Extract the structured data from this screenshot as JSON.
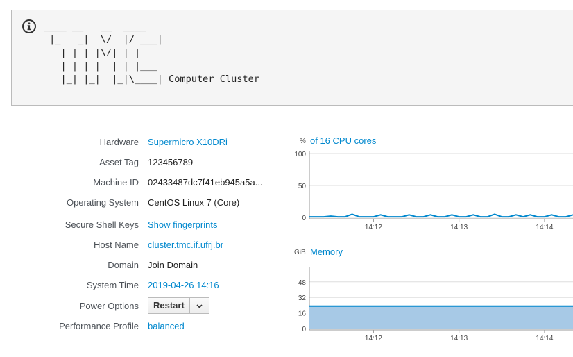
{
  "banner": {
    "motd": "____ __   __  ____\n |_   _|  \\/  |/ ___|\n   | | | |\\/| | |\n   | | | |  | | |___\n   |_| |_|  |_|\\____| Computer Cluster",
    "icon": "info-circle-icon"
  },
  "details": {
    "hardware": {
      "label": "Hardware",
      "value": "Supermicro X10DRi"
    },
    "asset_tag": {
      "label": "Asset Tag",
      "value": "123456789"
    },
    "machine_id": {
      "label": "Machine ID",
      "value": "02433487dc7f41eb945a5a..."
    },
    "os": {
      "label": "Operating System",
      "value": "CentOS Linux 7 (Core)"
    },
    "ssh_keys": {
      "label": "Secure Shell Keys",
      "value": "Show fingerprints"
    },
    "host_name": {
      "label": "Host Name",
      "value": "cluster.tmc.if.ufrj.br"
    },
    "domain": {
      "label": "Domain",
      "value": "Join Domain"
    },
    "system_time": {
      "label": "System Time",
      "value": "2019-04-26 14:16"
    },
    "power_options": {
      "label": "Power Options",
      "button": "Restart",
      "caret_icon": "chevron-down-icon"
    },
    "performance_profile": {
      "label": "Performance Profile",
      "value": "balanced"
    }
  },
  "chart_data": [
    {
      "type": "line",
      "title": "of 16 CPU cores",
      "unit": "%",
      "y_ticks": [
        "100",
        "50",
        "0"
      ],
      "ylim": [
        0,
        100
      ],
      "x_ticks": [
        "14:12",
        "14:13",
        "14:14"
      ],
      "x": [
        "14:11:15",
        "14:11:20",
        "14:11:25",
        "14:11:30",
        "14:11:35",
        "14:11:40",
        "14:11:45",
        "14:11:50",
        "14:11:55",
        "14:12:00",
        "14:12:05",
        "14:12:10",
        "14:12:15",
        "14:12:20",
        "14:12:25",
        "14:12:30",
        "14:12:35",
        "14:12:40",
        "14:12:45",
        "14:12:50",
        "14:12:55",
        "14:13:00",
        "14:13:05",
        "14:13:10",
        "14:13:15",
        "14:13:20",
        "14:13:25",
        "14:13:30",
        "14:13:35",
        "14:13:40",
        "14:13:45",
        "14:13:50",
        "14:13:55",
        "14:14:00",
        "14:14:05",
        "14:14:10",
        "14:14:15",
        "14:14:20"
      ],
      "values": [
        1,
        1,
        1,
        2,
        1,
        1,
        5,
        1,
        1,
        1,
        4,
        1,
        1,
        1,
        4,
        1,
        1,
        4,
        1,
        1,
        4,
        1,
        1,
        4,
        1,
        1,
        5,
        1,
        1,
        4,
        1,
        4,
        1,
        1,
        4,
        1,
        1,
        4
      ],
      "color": "#0088ce"
    },
    {
      "type": "area",
      "title": "Memory",
      "unit": "GiB",
      "y_ticks": [
        "48",
        "32",
        "16",
        "0"
      ],
      "ylim": [
        0,
        60
      ],
      "x_ticks": [
        "14:12",
        "14:13",
        "14:14"
      ],
      "x": [
        "14:11:15",
        "14:12:00",
        "14:13:00",
        "14:14:00",
        "14:14:20"
      ],
      "values": [
        23,
        23,
        23,
        23,
        23
      ],
      "color": "#0088ce",
      "fill": "#a7c9e6"
    }
  ]
}
